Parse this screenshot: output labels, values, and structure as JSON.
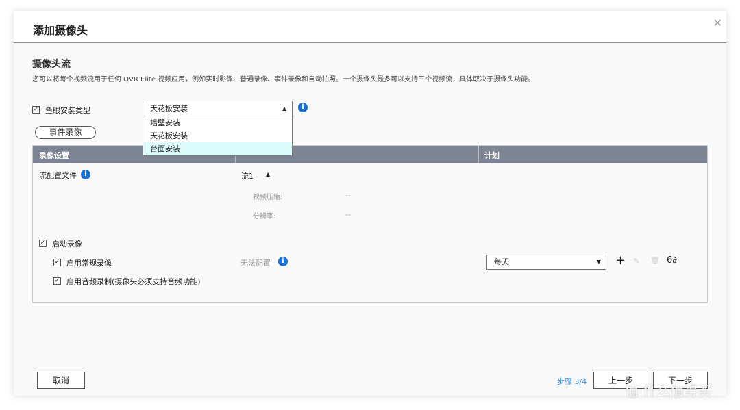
{
  "title": "添加摄像头",
  "section_title": "摄像头流",
  "description": "您可以将每个视频流用于任何 QVR Elite 视频应用，例如实时影像、普通录像、事件录像和自动拍照。一个摄像头最多可以支持三个视频流，具体取决于摄像头功能。",
  "fisheye": {
    "label": "鱼眼安装类型",
    "value": "天花板安装",
    "options": [
      "墙壁安装",
      "天花板安装",
      "台面安装"
    ]
  },
  "event_button": "事件录像",
  "table": {
    "headers": [
      "录像设置",
      "",
      "计划"
    ],
    "profile_label": "流配置文件",
    "stream": "流1",
    "compression_label": "视频压缩:",
    "compression_value": "--",
    "resolution_label": "分辨率:",
    "resolution_value": "--",
    "enable_recording": "启动录像",
    "regular": "启用常规录像",
    "unavailable": "无法配置",
    "audio": "启用音频录制(摄像头必须支持音频功能)",
    "schedule": "每天"
  },
  "footer": {
    "cancel": "取消",
    "step": "步骤 3/4",
    "prev": "上一步",
    "next": "下一步"
  },
  "watermark": "值 什么值得买",
  "colors": {
    "accent": "#1f6fd1",
    "header": "#7d8493",
    "highlight": "#dcfbfb",
    "step": "#3a8fe0"
  }
}
